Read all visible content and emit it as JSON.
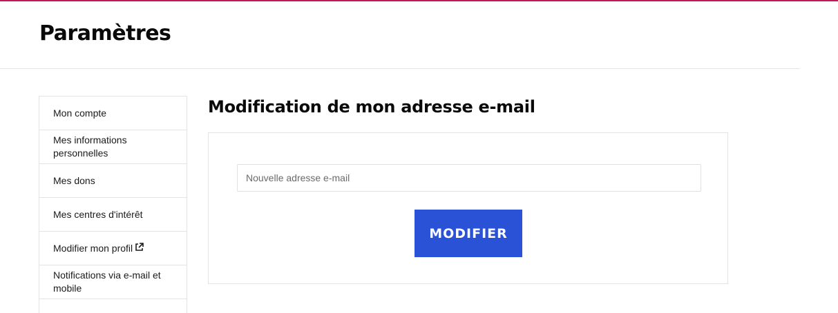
{
  "header": {
    "title": "Paramètres"
  },
  "sidebar": {
    "items": [
      {
        "label": "Mon compte"
      },
      {
        "label": "Mes informations personnelles"
      },
      {
        "label": "Mes dons"
      },
      {
        "label": "Mes centres d'intérêt"
      },
      {
        "label": "Modifier mon profil",
        "icon": "external-link-icon"
      },
      {
        "label": "Notifications via e-mail et mobile"
      }
    ]
  },
  "main": {
    "title": "Modification de mon adresse e-mail",
    "email_input": {
      "value": "",
      "placeholder": "Nouvelle adresse e-mail"
    },
    "submit_label": "MODIFIER"
  },
  "colors": {
    "accent_bar": "#c2185b",
    "primary_button": "#2a52d6"
  }
}
